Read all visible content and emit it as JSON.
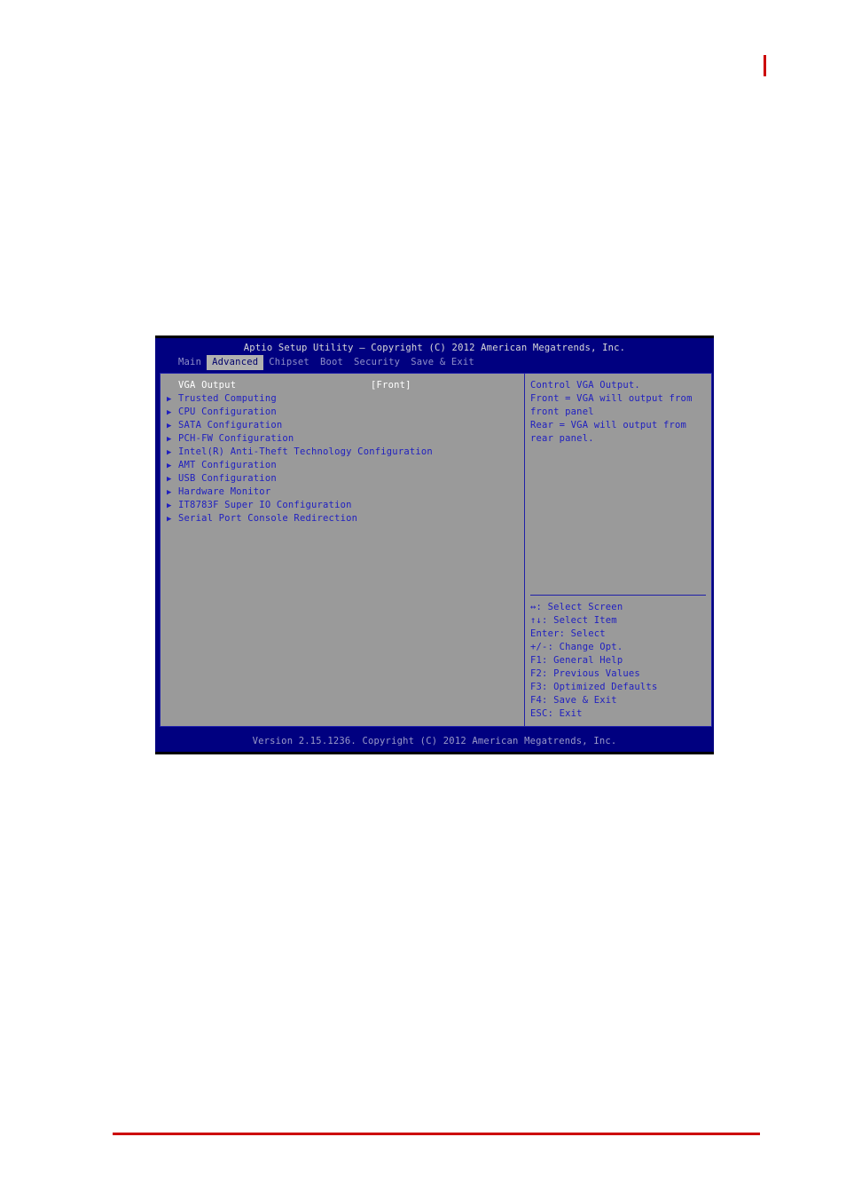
{
  "page": {
    "red_tick": "",
    "red_rule": ""
  },
  "bios": {
    "title": "Aptio Setup Utility – Copyright (C) 2012 American Megatrends, Inc.",
    "tabs": [
      {
        "label": "Main",
        "active": false
      },
      {
        "label": "Advanced",
        "active": true
      },
      {
        "label": "Chipset",
        "active": false
      },
      {
        "label": "Boot",
        "active": false
      },
      {
        "label": "Security",
        "active": false
      },
      {
        "label": "Save & Exit",
        "active": false
      }
    ],
    "menu": [
      {
        "bullet": "",
        "label": "VGA Output",
        "value": "[Front]",
        "selected": true
      },
      {
        "bullet": "▶",
        "label": "Trusted Computing",
        "value": "",
        "selected": false
      },
      {
        "bullet": "▶",
        "label": "CPU Configuration",
        "value": "",
        "selected": false
      },
      {
        "bullet": "▶",
        "label": "SATA Configuration",
        "value": "",
        "selected": false
      },
      {
        "bullet": "▶",
        "label": "PCH-FW Configuration",
        "value": "",
        "selected": false
      },
      {
        "bullet": "▶",
        "label": "Intel(R) Anti-Theft Technology Configuration",
        "value": "",
        "selected": false
      },
      {
        "bullet": "▶",
        "label": "AMT Configuration",
        "value": "",
        "selected": false
      },
      {
        "bullet": "▶",
        "label": "USB Configuration",
        "value": "",
        "selected": false
      },
      {
        "bullet": "▶",
        "label": "Hardware Monitor",
        "value": "",
        "selected": false
      },
      {
        "bullet": "▶",
        "label": "IT8783F Super IO Configuration",
        "value": "",
        "selected": false
      },
      {
        "bullet": "▶",
        "label": "Serial Port Console Redirection",
        "value": "",
        "selected": false
      }
    ],
    "help": [
      "Control VGA Output.",
      "Front = VGA will output from",
      "front panel",
      "Rear = VGA will output from",
      "rear panel."
    ],
    "keys": [
      "↔: Select Screen",
      "↑↓: Select Item",
      "Enter: Select",
      "+/-: Change Opt.",
      "F1: General Help",
      "F2: Previous Values",
      "F3: Optimized Defaults",
      "F4: Save & Exit",
      "ESC: Exit"
    ],
    "footer": "Version 2.15.1236. Copyright (C) 2012 American Megatrends, Inc."
  },
  "colors": {
    "bios_blue": "#000080",
    "panel_gray": "#9a9a9a",
    "text_blue": "#2020c0",
    "selected_text": "#ffffff",
    "accent_red": "#cc0000"
  }
}
